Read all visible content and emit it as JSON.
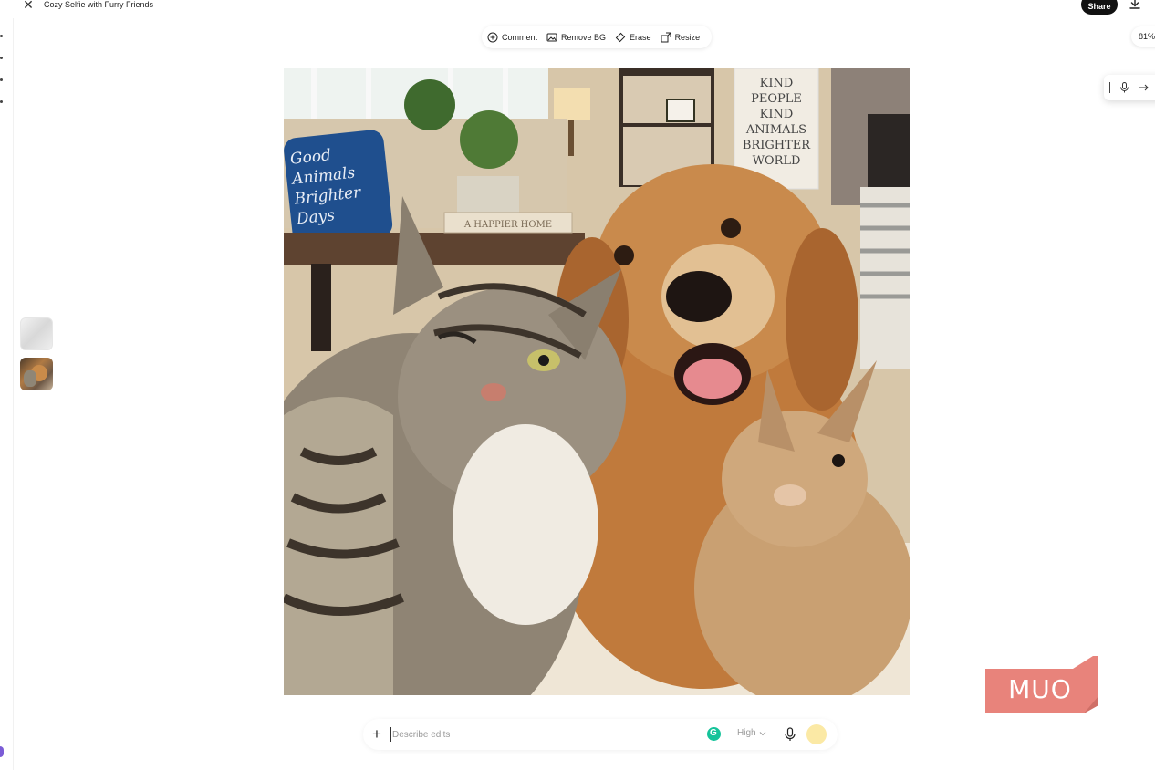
{
  "header": {
    "title": "Cozy Selfie with Furry Friends",
    "share_label": "Share",
    "icons": {
      "close": "close-icon",
      "download": "download-icon"
    }
  },
  "toolbar": {
    "items": [
      {
        "label": "Comment",
        "icon": "comment-icon"
      },
      {
        "label": "Remove BG",
        "icon": "remove-bg-icon"
      },
      {
        "label": "Erase",
        "icon": "eraser-icon"
      },
      {
        "label": "Resize",
        "icon": "resize-icon"
      }
    ]
  },
  "zoom": {
    "level": "81%"
  },
  "canvas": {
    "pillow_lines": [
      "Good",
      "Animals",
      "Brighter",
      "Days"
    ],
    "book_text": "A HAPPIER HOME",
    "sign_lines": [
      "KIND",
      "PEOPLE",
      "KIND",
      "ANIMALS",
      "BRIGHTER",
      "WORLD"
    ]
  },
  "watermark": {
    "text": "MUO",
    "color": "#e8837b"
  },
  "prompt": {
    "placeholder": "Describe edits",
    "quality_label": "High",
    "icons": {
      "add": "plus-icon",
      "grammarly": "grammarly-icon",
      "mic": "microphone-icon",
      "send": "send-icon"
    }
  },
  "colors": {
    "share_bg": "#111111",
    "send_bg": "#fbe9a5",
    "grammarly": "#15c39a"
  }
}
